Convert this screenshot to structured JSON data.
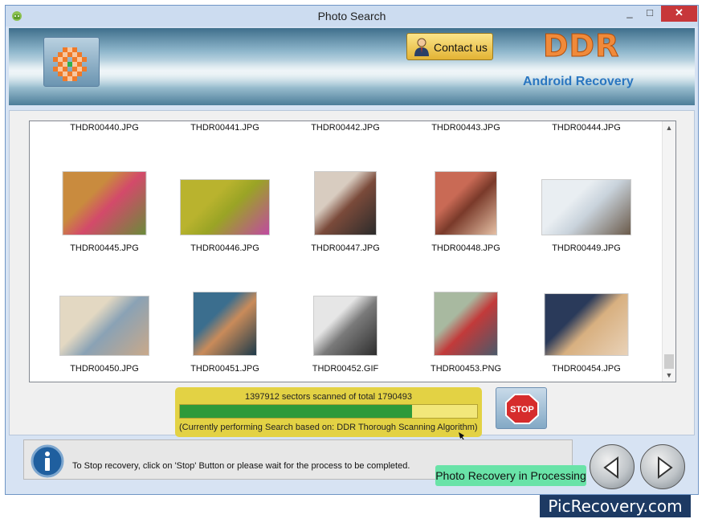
{
  "window": {
    "title": "Photo Search",
    "minimize": "_",
    "maximize": "□",
    "close": "✕"
  },
  "header": {
    "contact_label": "Contact us",
    "brand_logo": "DDR",
    "brand_sub": "Android Recovery"
  },
  "files": [
    {
      "name": "THDR00440.JPG",
      "has_thumb": false
    },
    {
      "name": "THDR00441.JPG",
      "has_thumb": false
    },
    {
      "name": "THDR00442.JPG",
      "has_thumb": false
    },
    {
      "name": "THDR00443.JPG",
      "has_thumb": false
    },
    {
      "name": "THDR00444.JPG",
      "has_thumb": false
    },
    {
      "name": "THDR00445.JPG",
      "has_thumb": true,
      "palette": [
        "#c98b3e",
        "#d34a6a",
        "#6a8a3a"
      ]
    },
    {
      "name": "THDR00446.JPG",
      "has_thumb": true,
      "palette": [
        "#b9b32e",
        "#9aa425",
        "#c04aa0"
      ]
    },
    {
      "name": "THDR00447.JPG",
      "has_thumb": true,
      "palette": [
        "#d8ccc0",
        "#7a4a3a",
        "#2b2b2b"
      ]
    },
    {
      "name": "THDR00448.JPG",
      "has_thumb": true,
      "palette": [
        "#c96a55",
        "#7a3a2a",
        "#e5c0a5"
      ]
    },
    {
      "name": "THDR00449.JPG",
      "has_thumb": true,
      "palette": [
        "#e9eef2",
        "#c9d3dc",
        "#6a5a4a"
      ]
    },
    {
      "name": "THDR00450.JPG",
      "has_thumb": true,
      "palette": [
        "#e3d8c2",
        "#8aa2b5",
        "#c9a98a"
      ]
    },
    {
      "name": "THDR00451.JPG",
      "has_thumb": true,
      "palette": [
        "#3b6e8e",
        "#c98b5a",
        "#1d3a4a"
      ]
    },
    {
      "name": "THDR00452.GIF",
      "has_thumb": true,
      "palette": [
        "#e6e6e6",
        "#7a7a7a",
        "#2e2e2e"
      ]
    },
    {
      "name": "THDR00453.PNG",
      "has_thumb": true,
      "palette": [
        "#a8b9a0",
        "#c23a3a",
        "#4a5a6a"
      ]
    },
    {
      "name": "THDR00454.JPG",
      "has_thumb": true,
      "palette": [
        "#2a3a5a",
        "#d8b080",
        "#e9d2b8"
      ]
    }
  ],
  "progress": {
    "status": "1397912 sectors scanned of total 1790493",
    "scanned": 1397912,
    "total": 1790493,
    "algorithm": "(Currently performing Search based on:  DDR Thorough Scanning Algorithm)"
  },
  "stop_label": "STOP",
  "status_bar": {
    "message": "To Stop recovery, click on 'Stop' Button or please wait for the process to be completed."
  },
  "callout": "Photo Recovery in Processing",
  "brand_footer": "PicRecovery.com",
  "colors": {
    "accent": "#2e9a3a",
    "callout": "#69e3a8",
    "progress_box": "#e3d244",
    "brand_bg": "#1d3a63"
  }
}
